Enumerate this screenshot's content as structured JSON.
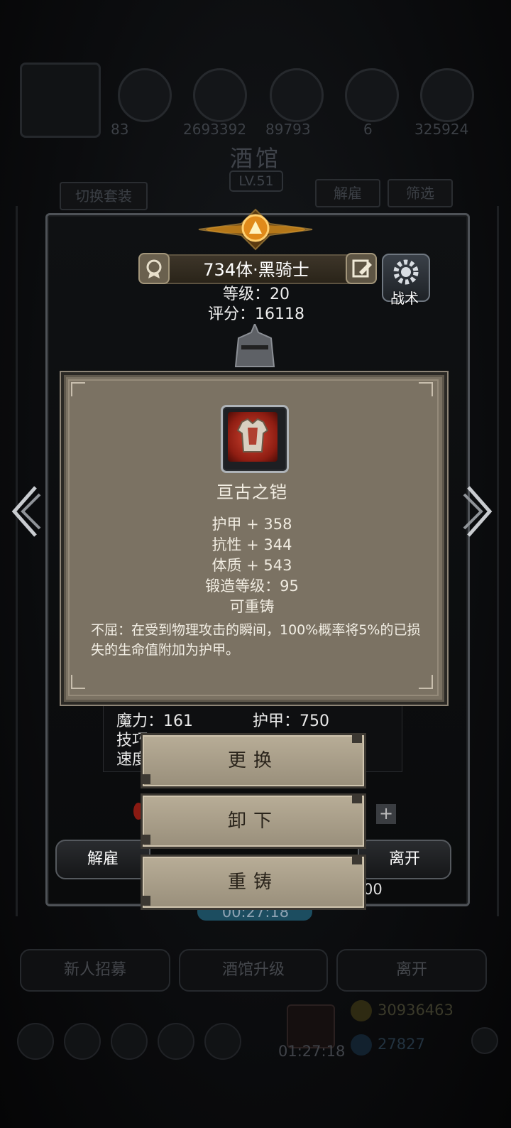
{
  "background": {
    "resource_numbers": [
      "83",
      "2693392",
      "89793",
      "6",
      "325924"
    ],
    "title": "酒馆",
    "level": "LV.51",
    "switch_outfit_label": "切换套装",
    "dismiss_label": "解雇",
    "filter_label": "筛选",
    "timer": "00:27:18",
    "bottom_buttons": [
      "新人招募",
      "酒馆升级",
      "离开"
    ],
    "gold": "30936463",
    "gems": "27827",
    "footer_timer": "01:27:18"
  },
  "hero": {
    "name": "734体·黑骑士",
    "level_line": "等级：20",
    "score_line": "评分：16118",
    "tactic_label": "战术",
    "stats": {
      "magic": "魔力：161",
      "armor": "护甲：750",
      "skill_partial": "技巧",
      "speed_partial": "速度"
    },
    "dismiss_label": "解雇",
    "leave_label": "离开",
    "plus_label": "+",
    "partial_number": "00"
  },
  "item_popup": {
    "name": "亘古之铠",
    "attributes": [
      "护甲 + 358",
      "抗性 + 344",
      "体质 + 543",
      "锻造等级：95",
      "可重铸"
    ],
    "description": "不屈：在受到物理攻击的瞬间，100%概率将5%的已损失的生命值附加为护甲。"
  },
  "actions": {
    "replace_label": "更换",
    "unequip_label": "卸下",
    "reforge_label": "重铸"
  },
  "colors": {
    "popup_bg": "#7b7263",
    "button_bg": "#b0a58f"
  }
}
